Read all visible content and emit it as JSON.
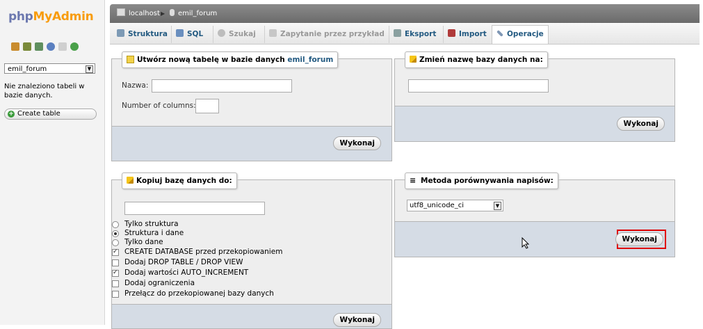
{
  "nav": {
    "logo_php": "php",
    "logo_my": "My",
    "logo_admin": "Admin",
    "icons": [
      "home-icon",
      "database-icon",
      "sql-icon",
      "query-icon",
      "docs-icon",
      "reload-icon"
    ],
    "db_select_value": "emil_forum",
    "no_tables_text": "Nie znaleziono tabeli w bazie danych.",
    "create_table_label": "Create table"
  },
  "breadcrumb": {
    "server": "localhost",
    "database": "emil_forum"
  },
  "tabs": [
    {
      "label": "Struktura",
      "icon": "structure-icon",
      "state": "normal"
    },
    {
      "label": "SQL",
      "icon": "sql-icon",
      "state": "normal"
    },
    {
      "label": "Szukaj",
      "icon": "search-icon",
      "state": "disabled"
    },
    {
      "label": "Zapytanie przez przykład",
      "icon": "query-icon",
      "state": "disabled"
    },
    {
      "label": "Eksport",
      "icon": "export-icon",
      "state": "normal"
    },
    {
      "label": "Import",
      "icon": "import-icon",
      "state": "normal"
    },
    {
      "label": "Operacje",
      "icon": "operations-icon",
      "state": "active"
    }
  ],
  "create_table": {
    "legend_prefix": "Utwórz nową tabelę w bazie danych",
    "legend_db": "emil_forum",
    "name_label": "Nazwa:",
    "columns_label": "Number of columns:",
    "submit_label": "Wykonaj"
  },
  "rename_db": {
    "legend": "Zmień nazwę bazy danych na:",
    "submit_label": "Wykonaj"
  },
  "copy_db": {
    "legend": "Kopiuj bazę danych do:",
    "options": [
      {
        "label": "Tylko struktura",
        "type": "radio",
        "checked": false
      },
      {
        "label": "Struktura i dane",
        "type": "radio",
        "checked": true
      },
      {
        "label": "Tylko dane",
        "type": "radio",
        "checked": false
      },
      {
        "label": "CREATE DATABASE przed przekopiowaniem",
        "type": "checkbox",
        "checked": true
      },
      {
        "label": "Dodaj DROP TABLE / DROP VIEW",
        "type": "checkbox",
        "checked": false
      },
      {
        "label": "Dodaj wartości AUTO_INCREMENT",
        "type": "checkbox",
        "checked": true
      },
      {
        "label": "Dodaj ograniczenia",
        "type": "checkbox",
        "checked": false
      },
      {
        "label": "Przełącz do przekopiowanej bazy danych",
        "type": "checkbox",
        "checked": false
      }
    ],
    "submit_label": "Wykonaj"
  },
  "collation": {
    "legend": "Metoda porównywania napisów:",
    "selected": "utf8_unicode_ci",
    "submit_label": "Wykonaj"
  },
  "colors": {
    "highlight": "#e00000",
    "tab_text": "#235a81",
    "db_link": "#235a81"
  }
}
